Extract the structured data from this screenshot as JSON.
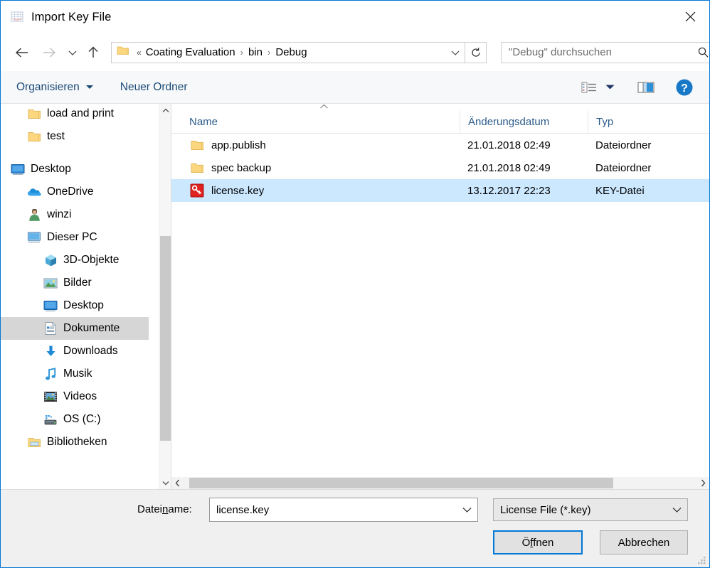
{
  "window": {
    "title": "Import Key File",
    "app_icon": "spreadsheet-icon",
    "close_label": "✕",
    "accent_color": "#0078d7"
  },
  "navbar": {
    "back_icon": "arrow-left-icon",
    "forward_icon": "arrow-right-icon",
    "recent_icon": "chevron-down-icon",
    "up_icon": "arrow-up-icon",
    "breadcrumb": {
      "folder_icon": "folder-icon",
      "overflow": "«",
      "separator": "›",
      "items": [
        "Coating Evaluation",
        "bin",
        "Debug"
      ]
    },
    "address_dropdown_icon": "chevron-down-icon",
    "refresh_icon": "refresh-icon",
    "search": {
      "placeholder": "\"Debug\" durchsuchen",
      "icon": "search-icon"
    }
  },
  "toolbar": {
    "organize_label": "Organisieren",
    "new_folder_label": "Neuer Ordner",
    "view_icon": "list-view-icon",
    "view_caret_icon": "chevron-down-icon",
    "preview_pane_icon": "preview-pane-icon",
    "help_icon": "help-icon",
    "help_label": "?"
  },
  "sidebar": {
    "items": [
      {
        "label": "load and print",
        "icon": "folder-icon",
        "level": 1,
        "selected": false
      },
      {
        "label": "test",
        "icon": "folder-icon",
        "level": 1,
        "selected": false
      },
      {
        "label": "Desktop",
        "icon": "desktop-icon",
        "level": 0,
        "selected": false
      },
      {
        "label": "OneDrive",
        "icon": "onedrive-cloud-icon",
        "level": 1,
        "selected": false
      },
      {
        "label": "winzi",
        "icon": "user-icon",
        "level": 1,
        "selected": false
      },
      {
        "label": "Dieser PC",
        "icon": "this-pc-icon",
        "level": 1,
        "selected": false
      },
      {
        "label": "3D-Objekte",
        "icon": "3d-objects-icon",
        "level": 2,
        "selected": false
      },
      {
        "label": "Bilder",
        "icon": "pictures-icon",
        "level": 2,
        "selected": false
      },
      {
        "label": "Desktop",
        "icon": "desktop-icon",
        "level": 2,
        "selected": false
      },
      {
        "label": "Dokumente",
        "icon": "documents-icon",
        "level": 2,
        "selected": true
      },
      {
        "label": "Downloads",
        "icon": "downloads-icon",
        "level": 2,
        "selected": false
      },
      {
        "label": "Musik",
        "icon": "music-icon",
        "level": 2,
        "selected": false
      },
      {
        "label": "Videos",
        "icon": "videos-icon",
        "level": 2,
        "selected": false
      },
      {
        "label": "OS (C:)",
        "icon": "drive-icon",
        "level": 2,
        "selected": false
      },
      {
        "label": "Bibliotheken",
        "icon": "libraries-icon",
        "level": 1,
        "selected": false
      }
    ],
    "scrollbar": {
      "up_icon": "chevron-up-icon",
      "down_icon": "chevron-down-icon"
    }
  },
  "filelist": {
    "sort_indicator_icon": "sort-ascending-icon",
    "columns": [
      "Name",
      "Änderungsdatum",
      "Typ"
    ],
    "rows": [
      {
        "name": "app.publish",
        "date": "21.01.2018 02:49",
        "type": "Dateiordner",
        "icon": "folder-icon",
        "selected": false
      },
      {
        "name": "spec backup",
        "date": "21.01.2018 02:49",
        "type": "Dateiordner",
        "icon": "folder-icon",
        "selected": false
      },
      {
        "name": "license.key",
        "date": "13.12.2017 22:23",
        "type": "KEY-Datei",
        "icon": "key-file-icon",
        "selected": true
      }
    ],
    "hscroll": {
      "left_icon": "chevron-left-icon",
      "right_icon": "chevron-right-icon"
    }
  },
  "footer": {
    "filename_label_pre": "Datei",
    "filename_label_acc": "n",
    "filename_label_post": "ame:",
    "filename_value": "license.key",
    "filename_caret_icon": "chevron-down-icon",
    "filter_value": "License File (*.key)",
    "filter_caret_icon": "chevron-down-icon",
    "open_label_pre": "Ö",
    "open_label_acc": "f",
    "open_label_post": "fnen",
    "cancel_label": "Abbrechen",
    "resize_grip_icon": "resize-grip-icon"
  }
}
